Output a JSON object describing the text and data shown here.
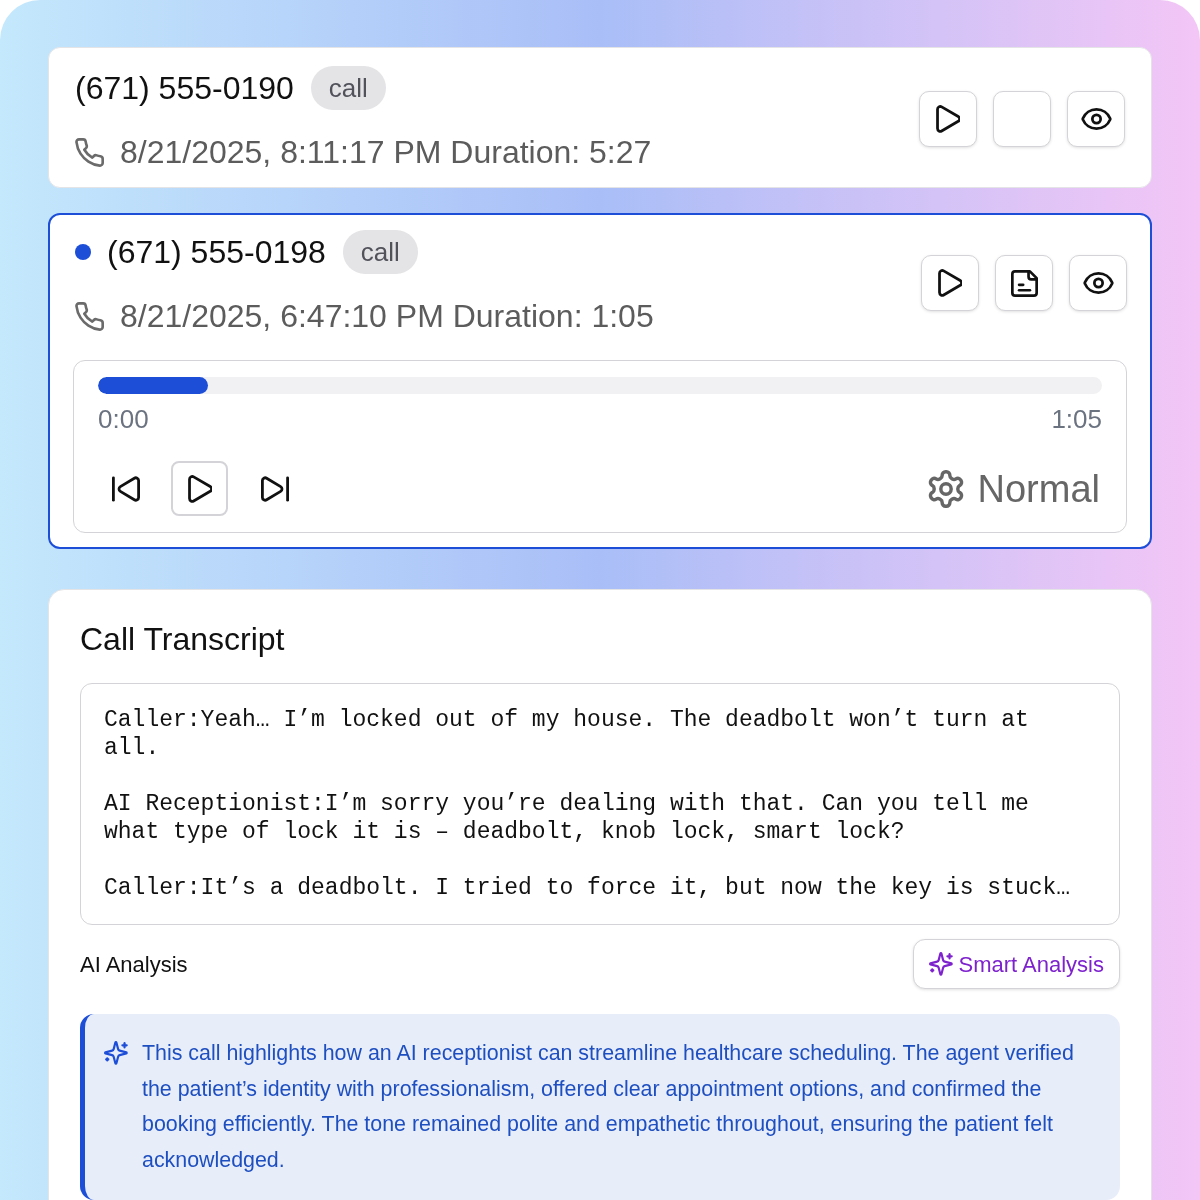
{
  "calls": [
    {
      "phone": "(671) 555-0190",
      "badge": "call",
      "details": "8/21/2025, 8:11:17 PM Duration: 5:27",
      "selected": false,
      "has_transcript": false
    },
    {
      "phone": "(671) 555-0198",
      "badge": "call",
      "details": "8/21/2025, 6:47:10 PM Duration: 1:05",
      "selected": true,
      "has_transcript": true,
      "player": {
        "level": 0.11,
        "elapsed": "0:00",
        "total": "1:05",
        "speed": "Normal"
      }
    }
  ],
  "transcript": {
    "title": "Call Transcript",
    "messages": [
      "Caller:Yeah… I’m locked out of my house. The deadbolt won’t turn at all.",
      "AI Receptionist:I’m sorry you’re dealing with that. Can you tell me what type of lock it is – deadbolt, knob lock, smart lock?",
      "Caller:It’s a deadbolt. I tried to force it, but now the key is stuck…"
    ],
    "analysis": {
      "label": "AI Analysis",
      "button": "Smart Analysis",
      "summary": "This call highlights how an AI receptionist can streamline healthcare scheduling. The agent verified the patient’s identity with professionalism, offered clear appointment options, and confirmed the booking efficiently. The tone remained polite and empathetic throughout, ensuring the patient felt acknowledged."
    }
  }
}
